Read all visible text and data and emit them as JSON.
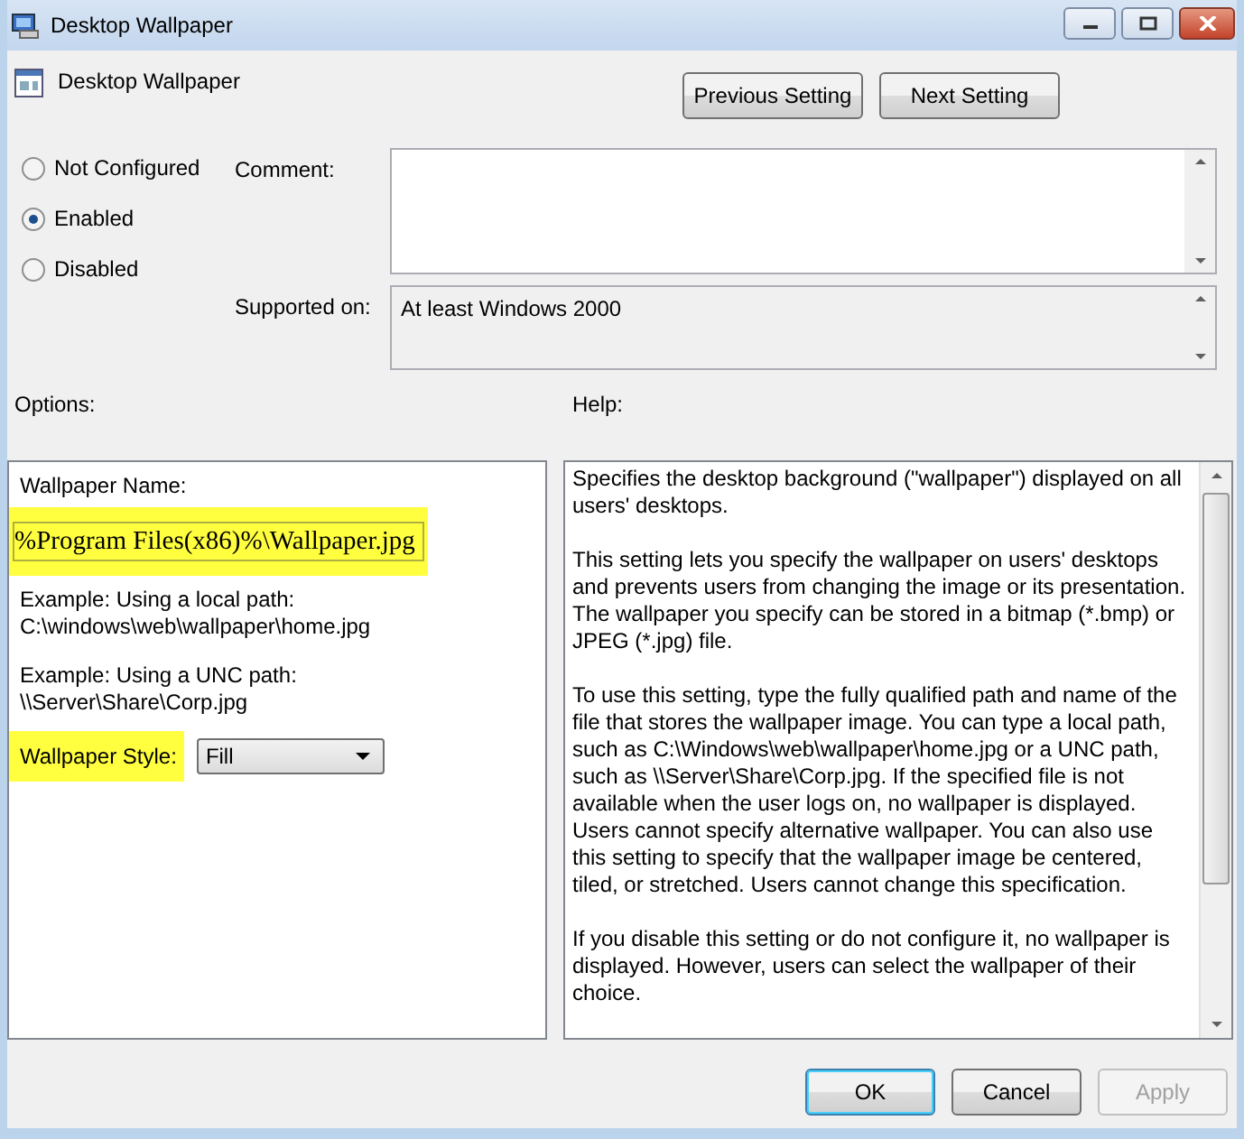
{
  "window": {
    "title": "Desktop Wallpaper"
  },
  "header": {
    "title": "Desktop Wallpaper",
    "buttons": [
      {
        "label": "Previous Setting"
      },
      {
        "label": "Next Setting"
      }
    ]
  },
  "state_options": [
    {
      "label": "Not Configured",
      "selected": false
    },
    {
      "label": "Enabled",
      "selected": true
    },
    {
      "label": "Disabled",
      "selected": false
    }
  ],
  "comment": {
    "label": "Comment:"
  },
  "supported_on": {
    "label": "Supported on:",
    "value": "At least Windows 2000"
  },
  "options": {
    "label": "Options:",
    "name_label": "Wallpaper Name:",
    "name_value": "%Program Files(x86)%\\Wallpaper.jpg",
    "name_highlighted": true,
    "examples": [
      {
        "title": "Example: Using a local path:",
        "path": "C:\\windows\\web\\wallpaper\\home.jpg"
      },
      {
        "title": "Example: Using a UNC path:",
        "path": "\\\\Server\\Share\\Corp.jpg"
      }
    ],
    "style_label": "Wallpaper Style:",
    "style_highlighted": true,
    "style_value": "Fill"
  },
  "help": {
    "label": "Help:",
    "paragraphs": [
      "Specifies the desktop background (\"wallpaper\") displayed on all users' desktops.",
      "This setting lets you specify the wallpaper on users' desktops and prevents users from changing the image or its presentation. The wallpaper you specify can be stored in a bitmap (*.bmp) or JPEG (*.jpg) file.",
      "To use this setting, type the fully qualified path and name of the file that stores the wallpaper image. You can type a local path, such as C:\\Windows\\web\\wallpaper\\home.jpg or a UNC path, such as \\\\Server\\Share\\Corp.jpg. If the specified file is not available when the user logs on, no wallpaper is displayed. Users cannot specify alternative wallpaper. You can also use this setting to specify that the wallpaper image be centered, tiled, or stretched. Users cannot change this specification.",
      "If you disable this setting or do not configure it, no wallpaper is displayed. However, users can select the wallpaper of their choice."
    ]
  },
  "buttons": [
    {
      "label": "OK",
      "default": true,
      "disabled": false
    },
    {
      "label": "Cancel",
      "default": false,
      "disabled": false
    },
    {
      "label": "Apply",
      "default": false,
      "disabled": true
    }
  ]
}
